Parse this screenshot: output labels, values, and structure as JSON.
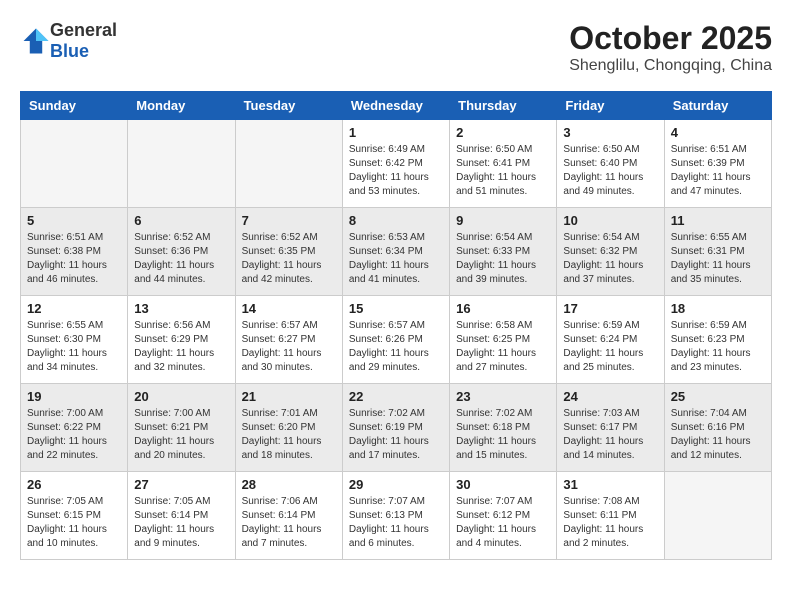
{
  "header": {
    "logo_general": "General",
    "logo_blue": "Blue",
    "month_title": "October 2025",
    "subtitle": "Shenglilu, Chongqing, China"
  },
  "weekdays": [
    "Sunday",
    "Monday",
    "Tuesday",
    "Wednesday",
    "Thursday",
    "Friday",
    "Saturday"
  ],
  "weeks": [
    [
      {
        "day": "",
        "info": ""
      },
      {
        "day": "",
        "info": ""
      },
      {
        "day": "",
        "info": ""
      },
      {
        "day": "1",
        "info": "Sunrise: 6:49 AM\nSunset: 6:42 PM\nDaylight: 11 hours\nand 53 minutes."
      },
      {
        "day": "2",
        "info": "Sunrise: 6:50 AM\nSunset: 6:41 PM\nDaylight: 11 hours\nand 51 minutes."
      },
      {
        "day": "3",
        "info": "Sunrise: 6:50 AM\nSunset: 6:40 PM\nDaylight: 11 hours\nand 49 minutes."
      },
      {
        "day": "4",
        "info": "Sunrise: 6:51 AM\nSunset: 6:39 PM\nDaylight: 11 hours\nand 47 minutes."
      }
    ],
    [
      {
        "day": "5",
        "info": "Sunrise: 6:51 AM\nSunset: 6:38 PM\nDaylight: 11 hours\nand 46 minutes."
      },
      {
        "day": "6",
        "info": "Sunrise: 6:52 AM\nSunset: 6:36 PM\nDaylight: 11 hours\nand 44 minutes."
      },
      {
        "day": "7",
        "info": "Sunrise: 6:52 AM\nSunset: 6:35 PM\nDaylight: 11 hours\nand 42 minutes."
      },
      {
        "day": "8",
        "info": "Sunrise: 6:53 AM\nSunset: 6:34 PM\nDaylight: 11 hours\nand 41 minutes."
      },
      {
        "day": "9",
        "info": "Sunrise: 6:54 AM\nSunset: 6:33 PM\nDaylight: 11 hours\nand 39 minutes."
      },
      {
        "day": "10",
        "info": "Sunrise: 6:54 AM\nSunset: 6:32 PM\nDaylight: 11 hours\nand 37 minutes."
      },
      {
        "day": "11",
        "info": "Sunrise: 6:55 AM\nSunset: 6:31 PM\nDaylight: 11 hours\nand 35 minutes."
      }
    ],
    [
      {
        "day": "12",
        "info": "Sunrise: 6:55 AM\nSunset: 6:30 PM\nDaylight: 11 hours\nand 34 minutes."
      },
      {
        "day": "13",
        "info": "Sunrise: 6:56 AM\nSunset: 6:29 PM\nDaylight: 11 hours\nand 32 minutes."
      },
      {
        "day": "14",
        "info": "Sunrise: 6:57 AM\nSunset: 6:27 PM\nDaylight: 11 hours\nand 30 minutes."
      },
      {
        "day": "15",
        "info": "Sunrise: 6:57 AM\nSunset: 6:26 PM\nDaylight: 11 hours\nand 29 minutes."
      },
      {
        "day": "16",
        "info": "Sunrise: 6:58 AM\nSunset: 6:25 PM\nDaylight: 11 hours\nand 27 minutes."
      },
      {
        "day": "17",
        "info": "Sunrise: 6:59 AM\nSunset: 6:24 PM\nDaylight: 11 hours\nand 25 minutes."
      },
      {
        "day": "18",
        "info": "Sunrise: 6:59 AM\nSunset: 6:23 PM\nDaylight: 11 hours\nand 23 minutes."
      }
    ],
    [
      {
        "day": "19",
        "info": "Sunrise: 7:00 AM\nSunset: 6:22 PM\nDaylight: 11 hours\nand 22 minutes."
      },
      {
        "day": "20",
        "info": "Sunrise: 7:00 AM\nSunset: 6:21 PM\nDaylight: 11 hours\nand 20 minutes."
      },
      {
        "day": "21",
        "info": "Sunrise: 7:01 AM\nSunset: 6:20 PM\nDaylight: 11 hours\nand 18 minutes."
      },
      {
        "day": "22",
        "info": "Sunrise: 7:02 AM\nSunset: 6:19 PM\nDaylight: 11 hours\nand 17 minutes."
      },
      {
        "day": "23",
        "info": "Sunrise: 7:02 AM\nSunset: 6:18 PM\nDaylight: 11 hours\nand 15 minutes."
      },
      {
        "day": "24",
        "info": "Sunrise: 7:03 AM\nSunset: 6:17 PM\nDaylight: 11 hours\nand 14 minutes."
      },
      {
        "day": "25",
        "info": "Sunrise: 7:04 AM\nSunset: 6:16 PM\nDaylight: 11 hours\nand 12 minutes."
      }
    ],
    [
      {
        "day": "26",
        "info": "Sunrise: 7:05 AM\nSunset: 6:15 PM\nDaylight: 11 hours\nand 10 minutes."
      },
      {
        "day": "27",
        "info": "Sunrise: 7:05 AM\nSunset: 6:14 PM\nDaylight: 11 hours\nand 9 minutes."
      },
      {
        "day": "28",
        "info": "Sunrise: 7:06 AM\nSunset: 6:14 PM\nDaylight: 11 hours\nand 7 minutes."
      },
      {
        "day": "29",
        "info": "Sunrise: 7:07 AM\nSunset: 6:13 PM\nDaylight: 11 hours\nand 6 minutes."
      },
      {
        "day": "30",
        "info": "Sunrise: 7:07 AM\nSunset: 6:12 PM\nDaylight: 11 hours\nand 4 minutes."
      },
      {
        "day": "31",
        "info": "Sunrise: 7:08 AM\nSunset: 6:11 PM\nDaylight: 11 hours\nand 2 minutes."
      },
      {
        "day": "",
        "info": ""
      }
    ]
  ]
}
